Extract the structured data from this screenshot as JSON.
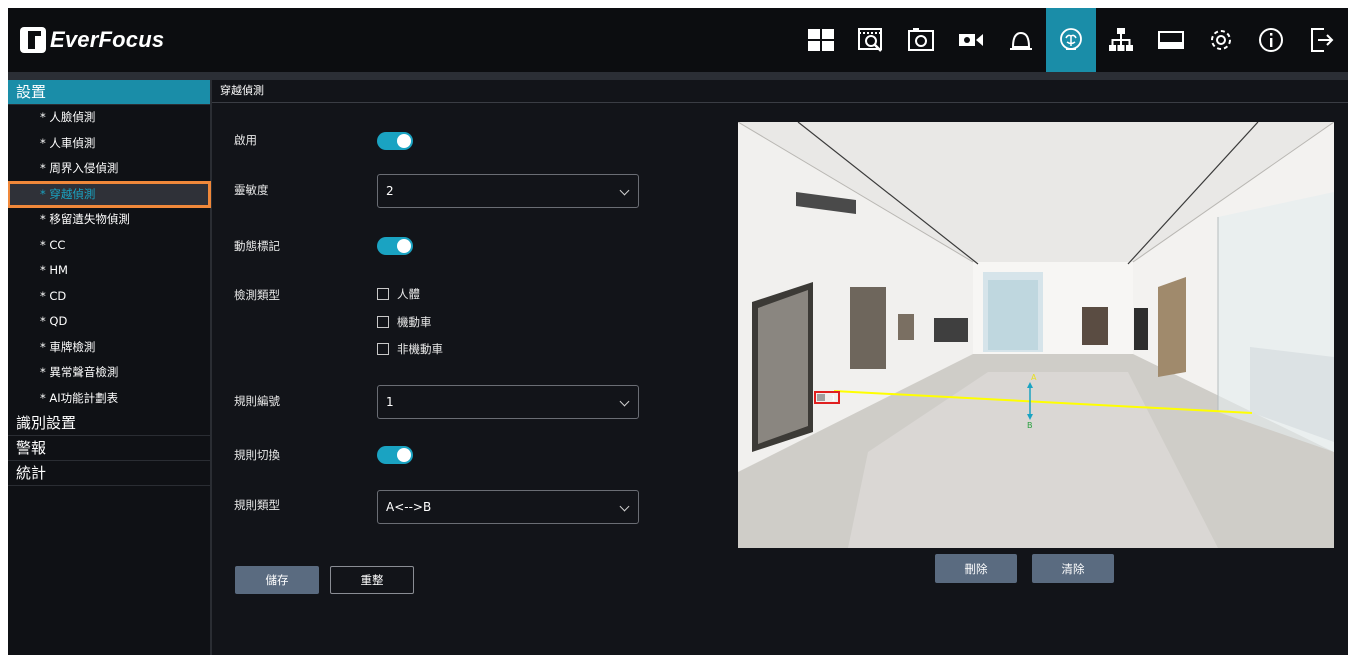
{
  "brand": {
    "name": "EverFocus"
  },
  "toolbar": {
    "active_index": 5,
    "icons": [
      "layout-grid-icon",
      "playback-icon",
      "snapshot-icon",
      "camera-icon",
      "alarm-bell-icon",
      "ai-brain-icon",
      "network-icon",
      "storage-icon",
      "settings-gear-icon",
      "info-icon",
      "logout-icon"
    ]
  },
  "sidebar": {
    "sections": [
      {
        "label": "設置",
        "active": true
      },
      {
        "label": "識別設置"
      },
      {
        "label": "警報"
      },
      {
        "label": "統計"
      }
    ],
    "items": [
      {
        "label": "* 人臉偵測"
      },
      {
        "label": "* 人車偵測"
      },
      {
        "label": "* 周界入侵偵測"
      },
      {
        "label": "* 穿越偵測",
        "selected": true
      },
      {
        "label": "* 移留遺失物偵測"
      },
      {
        "label": "* CC"
      },
      {
        "label": "* HM"
      },
      {
        "label": "* CD"
      },
      {
        "label": "* QD"
      },
      {
        "label": "* 車牌檢測"
      },
      {
        "label": "* 異常聲音檢測"
      },
      {
        "label": "* AI功能計劃表"
      }
    ]
  },
  "main": {
    "title": "穿越偵測",
    "enable": {
      "label": "啟用",
      "on": true
    },
    "sensitivity": {
      "label": "靈敏度",
      "value": "2"
    },
    "dynamic_mark": {
      "label": "動態標記",
      "on": true
    },
    "detect_type": {
      "label": "檢測類型",
      "options": [
        {
          "label": "人體",
          "checked": false
        },
        {
          "label": "機動車",
          "checked": false
        },
        {
          "label": "非機動車",
          "checked": false
        }
      ]
    },
    "rule_number": {
      "label": "規則編號",
      "value": "1"
    },
    "rule_switch": {
      "label": "規則切換",
      "on": true
    },
    "rule_type": {
      "label": "規則類型",
      "value": "A<-->B"
    },
    "save_label": "儲存",
    "reset_label": "重整"
  },
  "preview": {
    "rule_tag": "1",
    "point_a": "A",
    "point_b": "B",
    "delete_label": "刪除",
    "clear_label": "清除"
  },
  "colors": {
    "accent": "#1a8da8",
    "toggle_on": "#1aa3c2",
    "selection_outline": "#f0883a",
    "rule_line": "#ffff00",
    "rule_box": "#e02020"
  }
}
